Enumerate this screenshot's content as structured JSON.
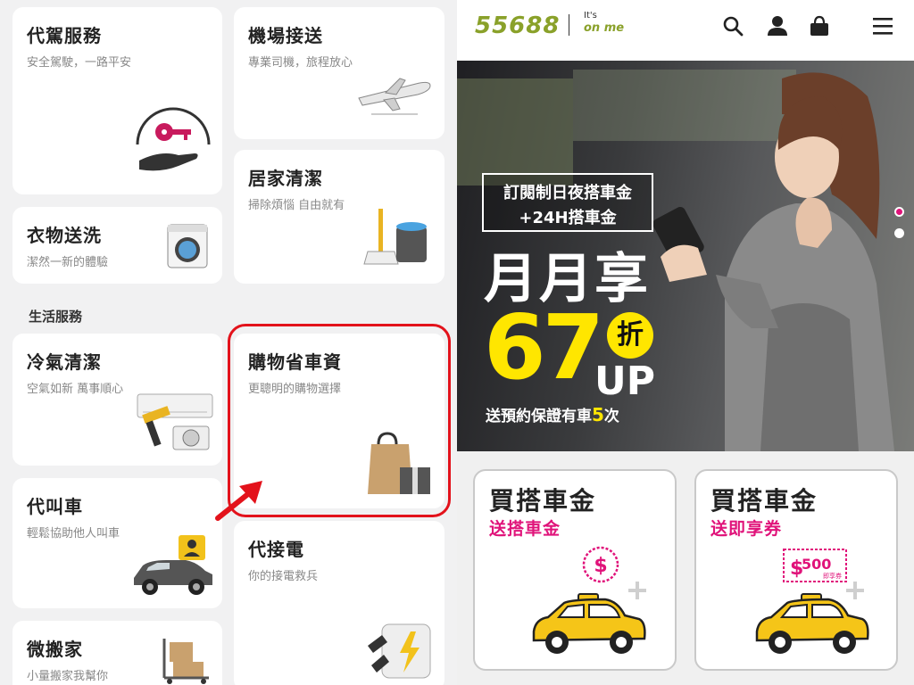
{
  "left_panel": {
    "cards": {
      "driver": {
        "title": "代駕服務",
        "subtitle": "安全駕駛，一路平安"
      },
      "airport": {
        "title": "機場接送",
        "subtitle": "專業司機，旅程放心"
      },
      "cleaning": {
        "title": "居家清潔",
        "subtitle": "掃除煩惱 自由就有"
      },
      "laundry": {
        "title": "衣物送洗",
        "subtitle": "潔然一新的體驗"
      },
      "aircon": {
        "title": "冷氣清潔",
        "subtitle": "空氣如新 萬事順心"
      },
      "shopping": {
        "title": "購物省車資",
        "subtitle": "更聰明的購物選擇"
      },
      "call_car": {
        "title": "代叫車",
        "subtitle": "輕鬆協助他人叫車"
      },
      "jumpstart": {
        "title": "代接電",
        "subtitle": "你的接電救兵"
      },
      "moving": {
        "title": "微搬家",
        "subtitle": "小量搬家我幫你"
      }
    },
    "section_label": "生活服務",
    "highlight_color": "#e3121b"
  },
  "right_panel": {
    "logo": "55688",
    "tagline_top": "It's",
    "tagline_bottom": "on me",
    "header_icons": [
      "search-icon",
      "user-icon",
      "shopping-bag-icon",
      "menu-icon"
    ],
    "banner": {
      "promo_line1": "訂閱制日夜搭車金",
      "promo_line2": "+24H搭車金",
      "big_title": "月月享",
      "discount": "67",
      "discount_unit": "折",
      "discount_suffix": "UP",
      "note_prefix": "送預約保證有車",
      "note_count": "5",
      "note_suffix": "次",
      "carousel_index": 1,
      "carousel_total": 2
    },
    "buy_cards": [
      {
        "title": "買搭車金",
        "subtitle": "送搭車金",
        "icon": "dollar-coin-icon"
      },
      {
        "title": "買搭車金",
        "subtitle": "送即享券",
        "voucher_amount": "500",
        "voucher_label": "即享券",
        "icon": "voucher-ticket-icon"
      }
    ],
    "colors": {
      "brand_green": "#8aa12a",
      "accent_pink": "#e0137a",
      "banner_yellow": "#ffe600"
    }
  }
}
